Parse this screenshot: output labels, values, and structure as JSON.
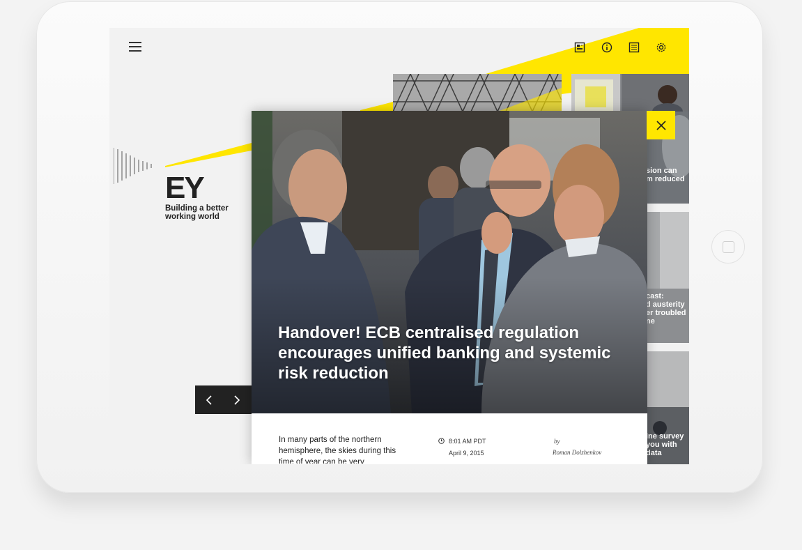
{
  "brand": {
    "logo_text": "EY",
    "tagline_line1": "Building a better",
    "tagline_line2": "working world"
  },
  "colors": {
    "accent_yellow": "#ffe600",
    "dark": "#222222"
  },
  "toolbar": {
    "menu_icon": "hamburger-icon",
    "icons": [
      "article-icon",
      "info-icon",
      "list-icon",
      "gear-icon"
    ]
  },
  "article": {
    "headline": "Handover! ECB centralised regulation encourages unified banking and systemic risk reduction",
    "lead": "In many parts of the northern hemisphere, the skies during this time of year can be very",
    "time": "8:01 AM PDT",
    "date": "April 9, 2015",
    "by_label": "by",
    "author": "Roman Dolzhenkov"
  },
  "side_cards": [
    {
      "line1": "sion can",
      "line2": "m reduced"
    },
    {
      "line1": "cast:",
      "line2": "d austerity",
      "line3": "er troubled",
      "line4": "ne"
    },
    {
      "line1": "ine survey",
      "line2": "you with",
      "line3": "data"
    }
  ],
  "nav": {
    "prev_icon": "chevron-left-icon",
    "next_icon": "chevron-right-icon"
  },
  "close_icon": "close-icon"
}
